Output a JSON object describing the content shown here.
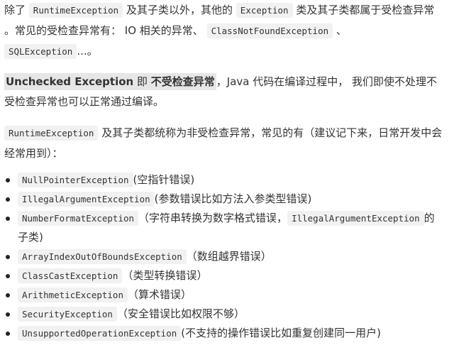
{
  "para1": {
    "t1": "除了",
    "c1": "RuntimeException",
    "t2": "及其子类以外，其他的",
    "c2": "Exception",
    "t3": "类及其子类都属于受检查异常 。常见的受检查异常有： IO 相关的异常、",
    "c3": "ClassNotFoundException",
    "t4": "、",
    "c4": "SQLException",
    "t5": "...。"
  },
  "para2": {
    "highlight_en": "Unchecked Exception",
    "highlight_mid": " 即 ",
    "highlight_cn": "不受检查异常",
    "rest": "，Java 代码在编译过程中， 我们即使不处理不受检查异常也可以正常通过编译。"
  },
  "para3": {
    "c1": "RuntimeException",
    "rest": "及其子类都统称为非受检查异常，常见的有（建议记下来，日常开发中会经常用到）："
  },
  "list": [
    {
      "code": "NullPointerException",
      "desc": "(空指针错误)"
    },
    {
      "code": "IllegalArgumentException",
      "desc": "(参数错误比如方法入参类型错误)"
    },
    {
      "code": "NumberFormatException",
      "desc": "（字符串转换为数字格式错误，",
      "code2": "IllegalArgumentException",
      "desc2": "的子类)"
    },
    {
      "code": "ArrayIndexOutOfBoundsException",
      "desc": "（数组越界错误）"
    },
    {
      "code": "ClassCastException",
      "desc": "（类型转换错误）"
    },
    {
      "code": "ArithmeticException",
      "desc": "（算术错误）"
    },
    {
      "code": "SecurityException",
      "desc": "（安全错误比如权限不够）"
    },
    {
      "code": "UnsupportedOperationException",
      "desc": "(不支持的操作错误比如重复创建同一用户)"
    }
  ]
}
